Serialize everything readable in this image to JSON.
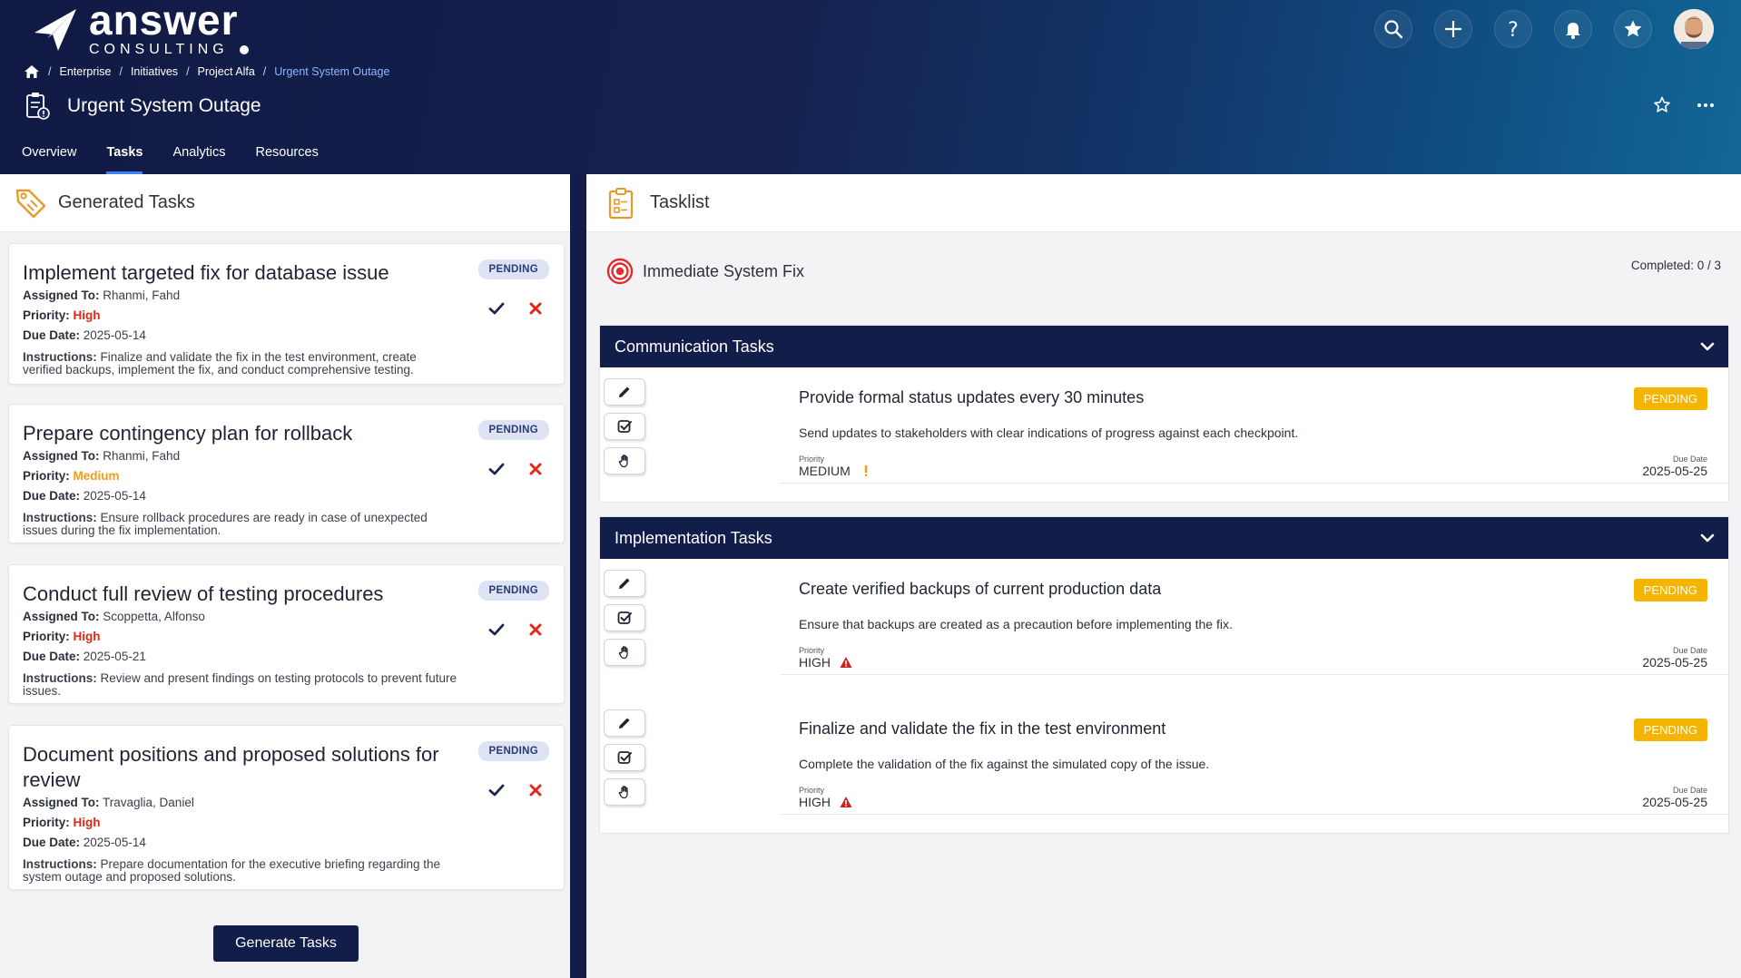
{
  "brand": {
    "word": "answer",
    "sub": "CONSULTING"
  },
  "header_icons": [
    "search-icon",
    "plus-icon",
    "help-icon",
    "bell-icon",
    "star-icon"
  ],
  "breadcrumb": {
    "items": [
      "Enterprise",
      "Initiatives",
      "Project Alfa",
      "Urgent System Outage"
    ]
  },
  "page": {
    "title": "Urgent System Outage"
  },
  "tabs": [
    "Overview",
    "Tasks",
    "Analytics",
    "Resources"
  ],
  "active_tab": "Tasks",
  "generated": {
    "header": "Generated Tasks",
    "labels": {
      "assigned": "Assigned To:",
      "priority": "Priority:",
      "due": "Due Date:",
      "instructions": "Instructions:"
    },
    "tasks": [
      {
        "title": "Implement targeted fix for database issue",
        "status": "PENDING",
        "assigned": "Rhanmi, Fahd",
        "priority": "High",
        "due": "2025-05-14",
        "instructions": "Finalize and validate the fix in the test environment, create verified backups, implement the fix, and conduct comprehensive testing."
      },
      {
        "title": "Prepare contingency plan for rollback",
        "status": "PENDING",
        "assigned": "Rhanmi, Fahd",
        "priority": "Medium",
        "due": "2025-05-14",
        "instructions": "Ensure rollback procedures are ready in case of unexpected issues during the fix implementation."
      },
      {
        "title": "Conduct full review of testing procedures",
        "status": "PENDING",
        "assigned": "Scoppetta, Alfonso",
        "priority": "High",
        "due": "2025-05-21",
        "instructions": "Review and present findings on testing protocols to prevent future issues."
      },
      {
        "title": "Document positions and proposed solutions for review",
        "status": "PENDING",
        "assigned": "Travaglia, Daniel",
        "priority": "High",
        "due": "2025-05-14",
        "instructions": "Prepare documentation for the executive briefing regarding the system outage and proposed solutions."
      }
    ],
    "button": "Generate Tasks"
  },
  "tasklist": {
    "header": "Tasklist",
    "objective": "Immediate System Fix",
    "completed_label": "Completed:",
    "completed_value": "0 / 3",
    "labels": {
      "priority": "Priority",
      "due": "Due Date"
    },
    "groups": [
      {
        "name": "Communication Tasks",
        "tasks": [
          {
            "title": "Provide formal status updates every 30 minutes",
            "status": "PENDING",
            "desc": "Send updates to stakeholders with clear indications of progress against each checkpoint.",
            "priority": "MEDIUM",
            "due": "2025-05-25"
          }
        ]
      },
      {
        "name": "Implementation Tasks",
        "tasks": [
          {
            "title": "Create verified backups of current production data",
            "status": "PENDING",
            "desc": "Ensure that backups are created as a precaution before implementing the fix.",
            "priority": "HIGH",
            "due": "2025-05-25"
          },
          {
            "title": "Finalize and validate the fix in the test environment",
            "status": "PENDING",
            "desc": "Complete the validation of the fix against the simulated copy of the issue.",
            "priority": "HIGH",
            "due": "2025-05-25"
          }
        ]
      }
    ]
  },
  "colors": {
    "navy": "#121d4a",
    "pending_badge": "#f4b400",
    "high": "#e0291b",
    "medium": "#f39c12",
    "accent": "#3b82f6"
  }
}
